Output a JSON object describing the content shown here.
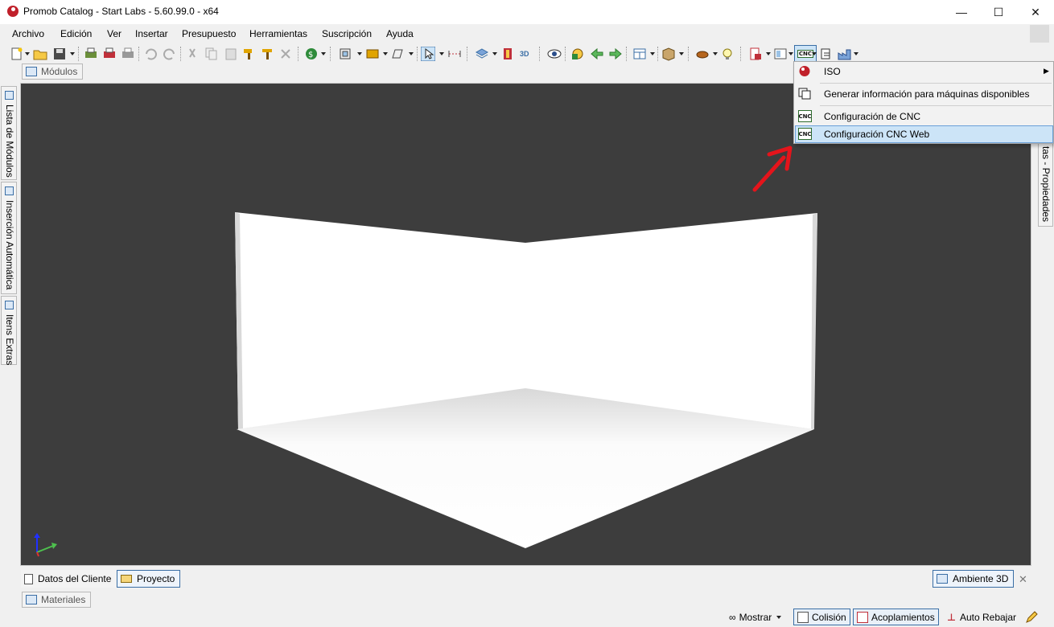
{
  "window": {
    "title": "Promob Catalog - Start Labs - 5.60.99.0 - x64",
    "minimize_glyph": "—",
    "maximize_glyph": "☐",
    "close_glyph": "✕"
  },
  "menubar": {
    "items": [
      "Archivo",
      "Edición",
      "Ver",
      "Insertar",
      "Presupuesto",
      "Herramientas",
      "Suscripción",
      "Ayuda"
    ]
  },
  "toolbar": {
    "cnc_label": "CNC",
    "view3d_label": "3D"
  },
  "tabs": {
    "top": "Módulos",
    "left_vertical": [
      "Lista de Módulos",
      "Inserción Automática",
      "Itens Extras"
    ],
    "right_vertical": "tas - Propiedades",
    "bottom": [
      "Datos del Cliente",
      "Proyecto"
    ],
    "bottom_right": "Ambiente 3D",
    "materials": "Materiales",
    "close_glyph": "✕"
  },
  "cnc_menu": {
    "items": [
      {
        "label": "ISO",
        "has_submenu": true,
        "icon": "globe-icon"
      },
      {
        "label": "Generar información para máquinas disponibles",
        "icon": "copy-icon"
      },
      {
        "label": "Configuración de CNC",
        "icon": "cnc-icon"
      },
      {
        "label": "Configuración CNC Web",
        "icon": "cnc-icon",
        "highlighted": true
      }
    ],
    "icon_text": "CNC",
    "submenu_arrow": "▶"
  },
  "statusbar": {
    "mostrar": "Mostrar",
    "colision": "Colisión",
    "acoplamientos": "Acoplamientos",
    "auto_rebajar": "Auto Rebajar"
  },
  "colors": {
    "viewport_bg": "#3d3d3d",
    "highlight": "#cce4f7",
    "annotation_arrow": "#e4141b"
  }
}
